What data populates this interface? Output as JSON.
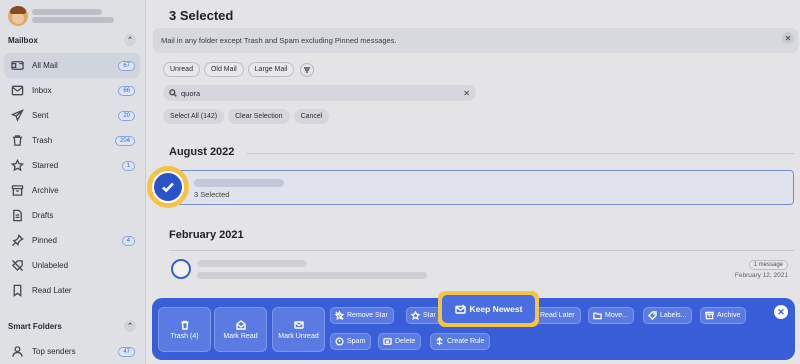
{
  "sidebar": {
    "mailbox_header": "Mailbox",
    "items": [
      {
        "label": "All Mail",
        "count": "67",
        "icon": "all-mail-icon"
      },
      {
        "label": "Inbox",
        "count": "66",
        "icon": "inbox-icon"
      },
      {
        "label": "Sent",
        "count": "20",
        "icon": "sent-icon"
      },
      {
        "label": "Trash",
        "count": "204",
        "icon": "trash-icon"
      },
      {
        "label": "Starred",
        "count": "1",
        "icon": "star-icon"
      },
      {
        "label": "Archive",
        "count": "",
        "icon": "archive-icon"
      },
      {
        "label": "Drafts",
        "count": "",
        "icon": "drafts-icon"
      },
      {
        "label": "Pinned",
        "count": "4",
        "icon": "pin-icon"
      },
      {
        "label": "Unlabeled",
        "count": "",
        "icon": "unlabeled-icon"
      },
      {
        "label": "Read Later",
        "count": "",
        "icon": "bookmark-icon"
      }
    ],
    "smart_folders_header": "Smart Folders",
    "smart_items": [
      {
        "label": "Top senders",
        "count": "47",
        "icon": "top-senders-icon"
      }
    ]
  },
  "main": {
    "title": "3 Selected",
    "notice": "Mail in any folder except Trash and Spam excluding Pinned messages.",
    "filters": [
      "Unread",
      "Old Mail",
      "Large Mail"
    ],
    "search": {
      "query": "quora"
    },
    "selection_actions": [
      "Select All (142)",
      "Clear Selection",
      "Cancel"
    ],
    "groups": [
      {
        "heading": "August 2022",
        "row_text": "3 Selected"
      },
      {
        "heading": "February 2021",
        "badge": "1 message",
        "date": "February 12, 2021"
      }
    ]
  },
  "actionbar": {
    "trash": "Trash (4)",
    "mark_read": "Mark Read",
    "mark_unread": "Mark Unread",
    "remove_star": "Remove Star",
    "star": "Star",
    "keep_newest": "Keep Newest",
    "read_later": "Read Later",
    "move": "Move...",
    "labels": "Labels...",
    "archive": "Archive",
    "spam": "Spam",
    "delete": "Delete",
    "create_rule": "Create Rule"
  },
  "colors": {
    "accent": "#3a5ed8",
    "highlight": "#f4c44a"
  }
}
